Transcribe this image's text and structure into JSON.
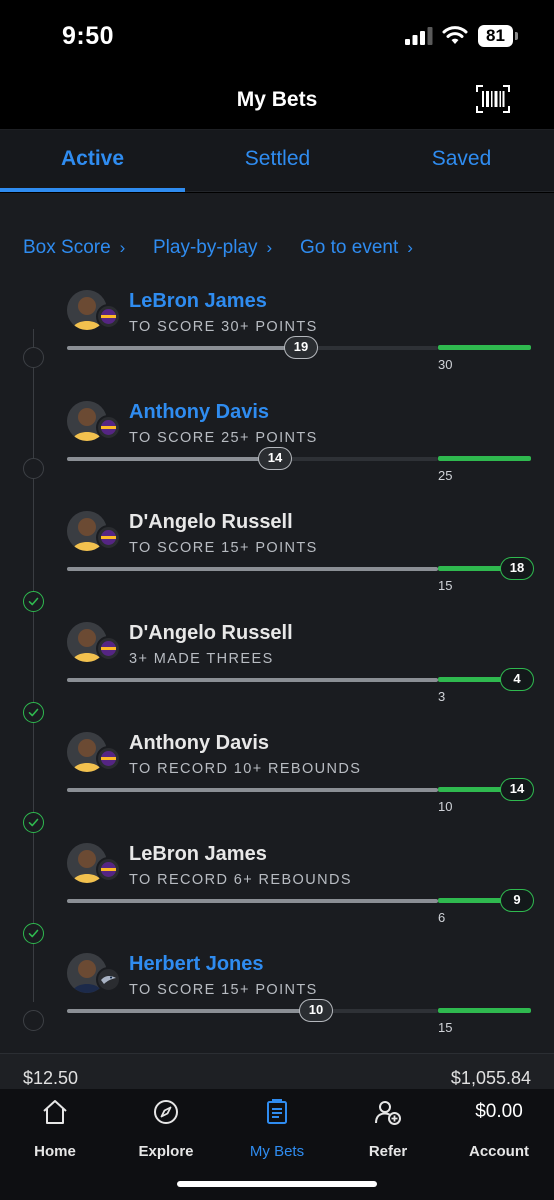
{
  "status_bar": {
    "time": "9:50",
    "battery": "81"
  },
  "header": {
    "title": "My Bets",
    "barcode_icon": "barcode-icon"
  },
  "tabs": [
    {
      "label": "Active",
      "active": true
    },
    {
      "label": "Settled",
      "active": false
    },
    {
      "label": "Saved",
      "active": false
    }
  ],
  "links": [
    {
      "label": "Box Score"
    },
    {
      "label": "Play-by-play"
    },
    {
      "label": "Go to event"
    }
  ],
  "legs": [
    {
      "player": "LeBron James",
      "team": "Lakers",
      "prop": "TO SCORE 30+ POINTS",
      "current": "19",
      "target": "30",
      "progress": 0.63,
      "status": "live"
    },
    {
      "player": "Anthony Davis",
      "team": "Lakers",
      "prop": "TO SCORE 25+ POINTS",
      "current": "14",
      "target": "25",
      "progress": 0.56,
      "status": "live"
    },
    {
      "player": "D'Angelo Russell",
      "team": "Lakers",
      "prop": "TO SCORE 15+ POINTS",
      "current": "18",
      "target": "15",
      "progress": 1.0,
      "status": "won"
    },
    {
      "player": "D'Angelo Russell",
      "team": "Lakers",
      "prop": "3+ MADE THREES",
      "current": "4",
      "target": "3",
      "progress": 1.0,
      "status": "won"
    },
    {
      "player": "Anthony Davis",
      "team": "Lakers",
      "prop": "TO RECORD 10+ REBOUNDS",
      "current": "14",
      "target": "10",
      "progress": 1.0,
      "status": "won"
    },
    {
      "player": "LeBron James",
      "team": "Lakers",
      "prop": "TO RECORD 6+ REBOUNDS",
      "current": "9",
      "target": "6",
      "progress": 1.0,
      "status": "won"
    },
    {
      "player": "Herbert Jones",
      "team": "Pelicans",
      "prop": "TO SCORE 15+ POINTS",
      "current": "10",
      "target": "15",
      "progress": 0.67,
      "status": "live"
    }
  ],
  "summary": {
    "stake": "$12.50",
    "payout": "$1,055.84"
  },
  "nav": [
    {
      "label": "Home",
      "icon": "home-icon"
    },
    {
      "label": "Explore",
      "icon": "compass-icon"
    },
    {
      "label": "My Bets",
      "icon": "betslip-icon",
      "active": true
    },
    {
      "label": "Refer",
      "icon": "add-user-icon"
    },
    {
      "label": "Account",
      "balance": "$0.00"
    }
  ],
  "colors": {
    "accent": "#2f8cf0",
    "win": "#2fb94f",
    "background": "#1a1c20"
  }
}
